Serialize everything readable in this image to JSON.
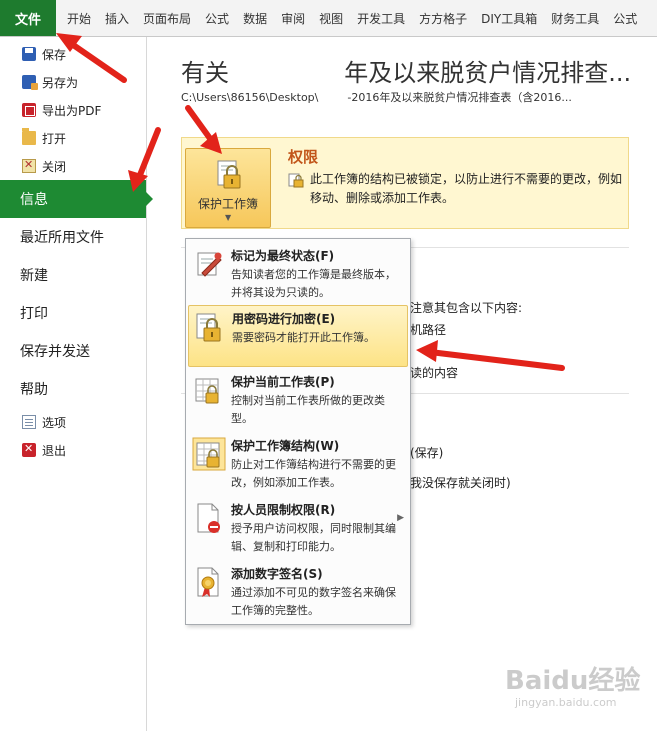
{
  "ribbon": {
    "file_tab": "文件",
    "tabs": [
      "开始",
      "插入",
      "页面布局",
      "公式",
      "数据",
      "审阅",
      "视图",
      "开发工具",
      "方方格子",
      "DIY工具箱",
      "财务工具",
      "公式"
    ]
  },
  "nav": {
    "save": "保存",
    "save_as": "另存为",
    "export_pdf": "导出为PDF",
    "open": "打开",
    "close": "关闭",
    "info": "信息",
    "recent": "最近所用文件",
    "new": "新建",
    "print": "打印",
    "save_send": "保存并发送",
    "help": "帮助",
    "options": "选项",
    "exit": "退出"
  },
  "main": {
    "title_left": "有关",
    "title_right": "年及以来脱贫户情况排查...",
    "path_left": "C:\\Users\\86156\\Desktop\\",
    "path_right": "-2016年及以来脱贫户情况排查表（含2016...",
    "protect_button": "保护工作簿",
    "permissions_title": "权限",
    "permissions_desc": "此工作簿的结构已被锁定，以防止进行不需要的更改，例如移动、删除或添加工作表。",
    "bg_prepare_1": "注意其包含以下内容:",
    "bg_prepare_2": "机路径",
    "bg_prepare_3": "读的内容",
    "bg_versions_1": "(保存)",
    "bg_versions_2": "我没保存就关闭时)"
  },
  "menu": {
    "items": [
      {
        "title": "标记为最终状态(F)",
        "desc": "告知读者您的工作簿是最终版本，并将其设为只读的。"
      },
      {
        "title": "用密码进行加密(E)",
        "desc": "需要密码才能打开此工作簿。"
      },
      {
        "title": "保护当前工作表(P)",
        "desc": "控制对当前工作表所做的更改类型。"
      },
      {
        "title": "保护工作簿结构(W)",
        "desc": "防止对工作簿结构进行不需要的更改，例如添加工作表。"
      },
      {
        "title": "按人员限制权限(R)",
        "desc": "授予用户访问权限，同时限制其编辑、复制和打印能力。"
      },
      {
        "title": "添加数字签名(S)",
        "desc": "通过添加不可见的数字签名来确保工作簿的完整性。"
      }
    ]
  },
  "watermark": {
    "brand": "Baidu经验",
    "url": "jingyan.baidu.com"
  },
  "colors": {
    "file_tab": "#1e7b2e",
    "nav_active": "#1e8a33",
    "permissions_title": "#c2561a",
    "highlight": "#fde386",
    "arrow": "#e2231a"
  }
}
